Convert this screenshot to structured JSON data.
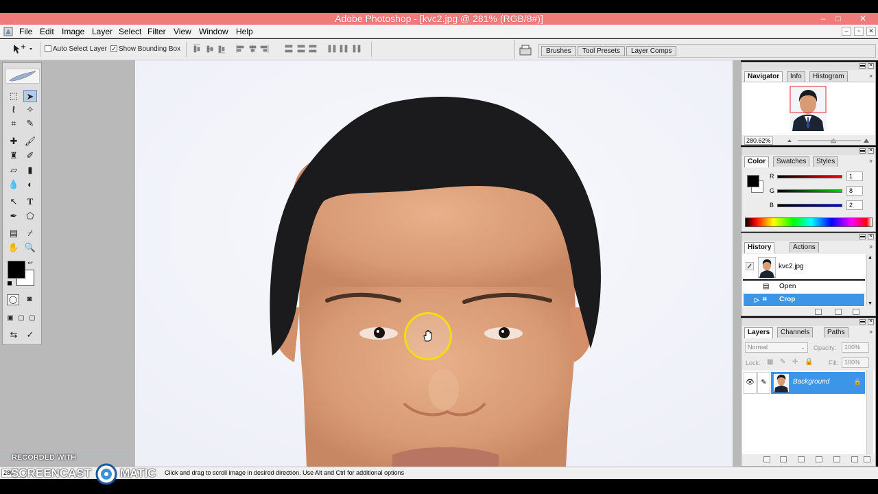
{
  "window": {
    "title": "Adobe Photoshop - [kvc2.jpg @ 281% (RGB/8#)]",
    "controls": [
      "–",
      "□",
      "✕"
    ]
  },
  "menubar": {
    "items": [
      "File",
      "Edit",
      "Image",
      "Layer",
      "Select",
      "Filter",
      "View",
      "Window",
      "Help"
    ],
    "doc_controls": [
      "–",
      "▫",
      "✕"
    ]
  },
  "options_bar": {
    "auto_select_layer": {
      "label": "Auto Select Layer",
      "checked": false
    },
    "show_bounding_box": {
      "label": "Show Bounding Box",
      "checked": true
    },
    "well_tabs": [
      "Brushes",
      "Tool Presets",
      "Layer Comps"
    ]
  },
  "navigator_panel": {
    "tabs": [
      "Navigator",
      "Info",
      "Histogram"
    ],
    "zoom": "280.62%"
  },
  "color_panel": {
    "tabs": [
      "Color",
      "Swatches",
      "Styles"
    ],
    "channels": [
      {
        "label": "R",
        "value": "1"
      },
      {
        "label": "G",
        "value": "8"
      },
      {
        "label": "B",
        "value": "2"
      }
    ]
  },
  "history_panel": {
    "tabs": [
      "History",
      "Actions"
    ],
    "snapshot": "kvc2.jpg",
    "states": [
      "Open",
      "Crop"
    ]
  },
  "layers_panel": {
    "tabs": [
      "Layers",
      "Channels",
      "Paths"
    ],
    "blend_mode": "Normal",
    "opacity_label": "Opacity:",
    "opacity": "100%",
    "lock_label": "Lock:",
    "fill_label": "Fill:",
    "fill": "100%",
    "layer_name": "Background"
  },
  "status": {
    "zoom": "280",
    "hint": "Click and drag to scroll image in desired direction.  Use Alt and Ctrl for additional options"
  },
  "watermark": {
    "line1": "RECORDED WITH",
    "brand_left": "SCREENCAST",
    "brand_right": "MATIC"
  },
  "colors": {
    "title_bar": "#f07b7b",
    "selection": "#3d95e8",
    "cursor_ring": "#f2dd12"
  },
  "icons": [
    "move-tool-icon",
    "hand-cursor-icon",
    "eye-icon",
    "brush-icon",
    "lock-icon",
    "trash-icon"
  ]
}
